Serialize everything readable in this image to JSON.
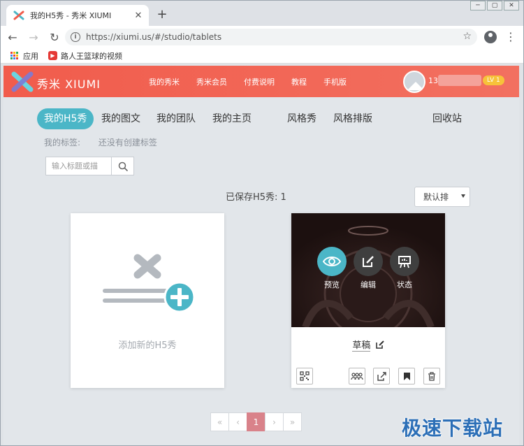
{
  "browser": {
    "tab_title": "我的H5秀 - 秀米 XIUMI",
    "new_tab": "+",
    "url": "https://xiumi.us/#/studio/tablets",
    "bookmarks": [
      "应用",
      "路人王篮球的视频"
    ]
  },
  "header": {
    "logo_text": "秀米 XIUMI",
    "nav": [
      "我的秀米",
      "秀米会员",
      "付费说明",
      "教程",
      "手机版"
    ],
    "user_prefix": "13",
    "level": "LV 1"
  },
  "subnav": {
    "items": [
      "我的H5秀",
      "我的图文",
      "我的团队",
      "我的主页",
      "风格秀",
      "风格排版",
      "回收站"
    ],
    "active": 0
  },
  "tags": {
    "label": "我的标签:",
    "empty": "还没有创建标签"
  },
  "search": {
    "placeholder": "输入标题或描"
  },
  "list": {
    "saved_label": "已保存H5秀: 1",
    "sort_value": "默认排"
  },
  "add_card": {
    "label": "添加新的H5秀"
  },
  "work_card": {
    "actions": [
      "预览",
      "编辑",
      "状态"
    ],
    "title": "草稿"
  },
  "pagination": {
    "first": "«",
    "prev": "‹",
    "current": "1",
    "next": "›",
    "last": "»"
  },
  "watermark": "极速下载站",
  "colors": {
    "brand": "#f15c4c",
    "accent": "#4bb6c7",
    "page_active": "#d9828a"
  }
}
